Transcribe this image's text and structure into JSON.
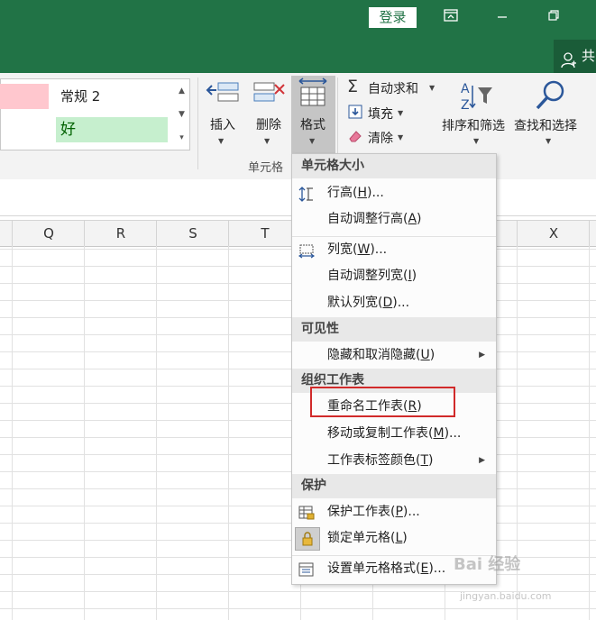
{
  "titlebar": {
    "login_label": "登录",
    "share_label": "共",
    "icons": [
      "ribbon-display-icon",
      "minimize-icon",
      "restore-icon",
      "person-icon"
    ]
  },
  "ribbon": {
    "styles": {
      "normal2": "常规 2",
      "good": "好"
    },
    "cells_group": {
      "insert_label": "插入",
      "delete_label": "删除",
      "format_label": "格式",
      "group_label": "单元格"
    },
    "editing_group": {
      "autosum_label": "自动求和",
      "fill_label": "填充",
      "clear_label": "清除",
      "sort_filter_label": "排序和筛选",
      "find_select_label": "查找和选择"
    }
  },
  "columns": [
    "Q",
    "R",
    "S",
    "T",
    "X"
  ],
  "menu": {
    "sections": [
      {
        "title": "单元格大小"
      },
      {
        "title": "可见性"
      },
      {
        "title": "组织工作表"
      },
      {
        "title": "保护"
      }
    ],
    "items": [
      {
        "text": "行高(",
        "acc": "H",
        "tail": ")..."
      },
      {
        "text": "自动调整行高(",
        "acc": "A",
        "tail": ")"
      },
      {
        "text": "列宽(",
        "acc": "W",
        "tail": ")..."
      },
      {
        "text": "自动调整列宽(",
        "acc": "I",
        "tail": ")"
      },
      {
        "text": "默认列宽(",
        "acc": "D",
        "tail": ")..."
      },
      {
        "text": "隐藏和取消隐藏(",
        "acc": "U",
        "tail": ")"
      },
      {
        "text": "重命名工作表(",
        "acc": "R",
        "tail": ")"
      },
      {
        "text": "移动或复制工作表(",
        "acc": "M",
        "tail": ")..."
      },
      {
        "text": "工作表标签颜色(",
        "acc": "T",
        "tail": ")"
      },
      {
        "text": "保护工作表(",
        "acc": "P",
        "tail": ")..."
      },
      {
        "text": "锁定单元格(",
        "acc": "L",
        "tail": ")"
      },
      {
        "text": "设置单元格格式(",
        "acc": "E",
        "tail": ")..."
      }
    ]
  },
  "watermark": {
    "text": "Bai 经验",
    "url": "jingyan.baidu.com"
  },
  "colors": {
    "excel_green": "#217346",
    "highlight_red": "#d12a2a",
    "good_fill": "#c6efce",
    "bad_fill": "#ffc7ce"
  }
}
